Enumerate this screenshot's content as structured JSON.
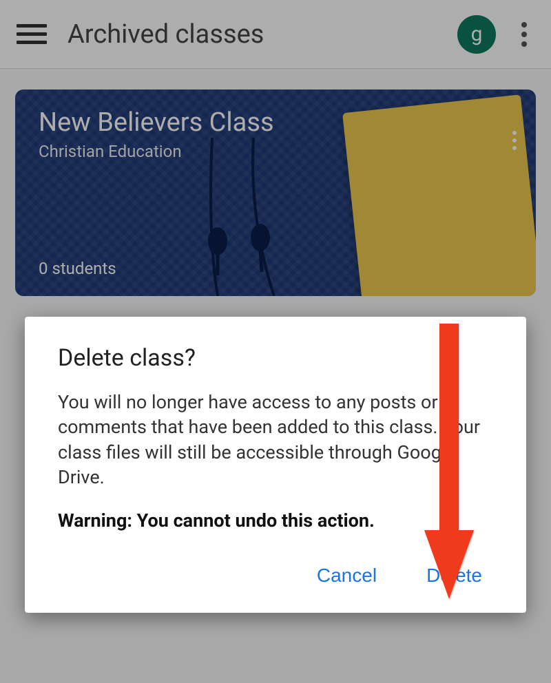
{
  "header": {
    "title": "Archived classes",
    "avatar_initial": "g"
  },
  "class_card": {
    "title": "New Believers Class",
    "subtitle": "Christian Education",
    "students": "0 students"
  },
  "dialog": {
    "title": "Delete class?",
    "body": "You will no longer have access to any posts or comments that have been added to this class. Your class files will still be accessible through Google Drive.",
    "warning": "Warning: You cannot undo this action.",
    "cancel_label": "Cancel",
    "delete_label": "Delete"
  }
}
